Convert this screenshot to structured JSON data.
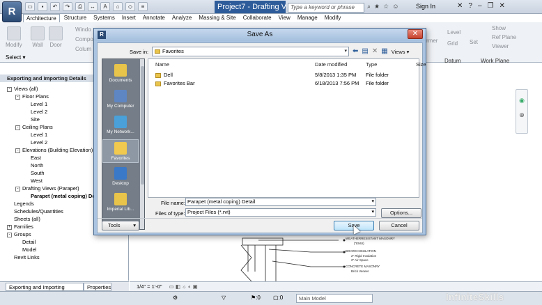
{
  "app": {
    "logo_letter": "R",
    "doc_title": "Project7 - Drafting Vi...",
    "help_search_placeholder": "Type a keyword or phrase",
    "sign_in": "Sign In"
  },
  "ribbon": {
    "tabs": [
      "Architecture",
      "Structure",
      "Systems",
      "Insert",
      "Annotate",
      "Analyze",
      "Massing & Site",
      "Collaborate",
      "View",
      "Manage",
      "Modify"
    ],
    "active_tab": "Architecture",
    "tools": [
      "Modify",
      "Wall",
      "Door",
      "Windo",
      "Compo",
      "Colum"
    ],
    "right_tools": [
      "Level",
      "Grid",
      "Set",
      "Show",
      "Ref Plane",
      "Viewer",
      "Datum",
      "Work Plane",
      "rmer"
    ],
    "select_label": "Select"
  },
  "project_browser": {
    "header": "Exporting and Importing Details",
    "nodes": [
      {
        "label": "Views (all)",
        "indent": 0,
        "toggle": "-",
        "bold": false
      },
      {
        "label": "Floor Plans",
        "indent": 1,
        "toggle": "-",
        "bold": false
      },
      {
        "label": "Level 1",
        "indent": 2,
        "toggle": "",
        "bold": false
      },
      {
        "label": "Level 2",
        "indent": 2,
        "toggle": "",
        "bold": false
      },
      {
        "label": "Site",
        "indent": 2,
        "toggle": "",
        "bold": false
      },
      {
        "label": "Ceiling Plans",
        "indent": 1,
        "toggle": "-",
        "bold": false
      },
      {
        "label": "Level 1",
        "indent": 2,
        "toggle": "",
        "bold": false
      },
      {
        "label": "Level 2",
        "indent": 2,
        "toggle": "",
        "bold": false
      },
      {
        "label": "Elevations (Building Elevation)",
        "indent": 1,
        "toggle": "-",
        "bold": false
      },
      {
        "label": "East",
        "indent": 2,
        "toggle": "",
        "bold": false
      },
      {
        "label": "North",
        "indent": 2,
        "toggle": "",
        "bold": false
      },
      {
        "label": "South",
        "indent": 2,
        "toggle": "",
        "bold": false
      },
      {
        "label": "West",
        "indent": 2,
        "toggle": "",
        "bold": false
      },
      {
        "label": "Drafting Views (Parapet)",
        "indent": 1,
        "toggle": "-",
        "bold": false
      },
      {
        "label": "Parapet (metal coping) Detail",
        "indent": 2,
        "toggle": "",
        "bold": true
      },
      {
        "label": "Legends",
        "indent": 0,
        "toggle": "",
        "bold": false
      },
      {
        "label": "Schedules/Quantities",
        "indent": 0,
        "toggle": "",
        "bold": false
      },
      {
        "label": "Sheets (all)",
        "indent": 0,
        "toggle": "",
        "bold": false
      },
      {
        "label": "Families",
        "indent": 0,
        "toggle": "+",
        "bold": false
      },
      {
        "label": "Groups",
        "indent": 0,
        "toggle": "-",
        "bold": false
      },
      {
        "label": "Detail",
        "indent": 1,
        "toggle": "",
        "bold": false
      },
      {
        "label": "Model",
        "indent": 1,
        "toggle": "",
        "bold": false
      },
      {
        "label": "Revit Links",
        "indent": 0,
        "toggle": "",
        "bold": false
      }
    ],
    "tab_browser": "Exporting and Importing Details",
    "tab_properties": "Properties"
  },
  "drawing": {
    "labels": [
      "WEATHERRESISTANT MASONRY",
      "(\"EMU)",
      "BOARD INSULATION",
      "2\" Rigid Insulation",
      "2\" Air Space",
      "CONCRETE MASONRY",
      "Brick Veneer"
    ],
    "view_scale": "1/4\" = 1'-0\""
  },
  "status": {
    "count_a": ":0",
    "count_b": ":0",
    "main_model": "Main Model"
  },
  "watermark": "InfiniteSkills",
  "dialog": {
    "title": "Save As",
    "save_in_label": "Save in:",
    "save_in_value": "Favorites",
    "views_label": "Views",
    "places": [
      {
        "label": "Documents",
        "color": "#e9c44a"
      },
      {
        "label": "My Computer",
        "color": "#5e86c2"
      },
      {
        "label": "My Network...",
        "color": "#4aa0d8"
      },
      {
        "label": "Favorites",
        "color": "#f0c94e"
      },
      {
        "label": "Desktop",
        "color": "#3a78c8"
      },
      {
        "label": "Imperial Lib...",
        "color": "#e9c44a"
      }
    ],
    "columns": [
      "Name",
      "Date modified",
      "Type",
      "Size"
    ],
    "rows": [
      {
        "name": "Dell",
        "date": "5/8/2013 1:35 PM",
        "type": "File folder",
        "size": ""
      },
      {
        "name": "Favorites Bar",
        "date": "6/18/2013 7:56 PM",
        "type": "File folder",
        "size": ""
      }
    ],
    "file_name_label": "File name:",
    "file_name_value": "Parapet (metal coping) Detail",
    "file_type_label": "Files of type:",
    "file_type_value": "Project Files  (*.rvt)",
    "options_button": "Options...",
    "tools_button": "Tools",
    "save_button": "Save",
    "cancel_button": "Cancel"
  }
}
